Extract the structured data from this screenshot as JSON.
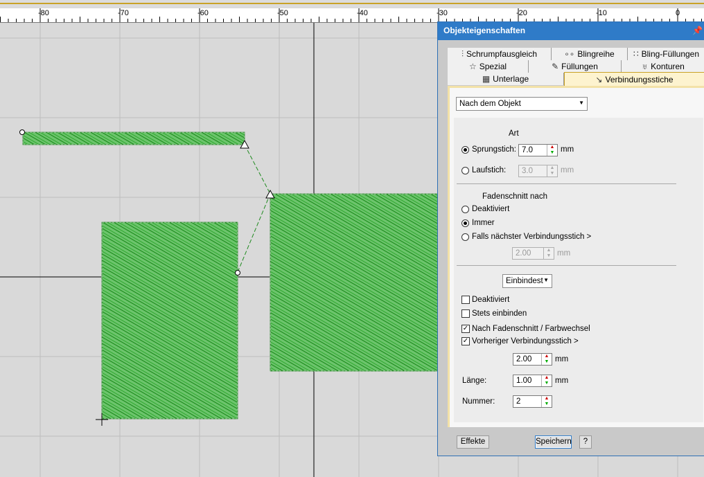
{
  "ruler": {
    "labels": [
      "-80",
      "-70",
      "-60",
      "-50",
      "-40",
      "-30",
      "-20",
      "-10",
      "0"
    ]
  },
  "colors": {
    "stitch_green": "#1f9a1f",
    "fill_green": "#5fbf5f",
    "dialog_blue": "#2f7bc8",
    "active_tab": "#fdf3cf"
  },
  "dialog": {
    "title": "Objekteigenschaften",
    "pin_icon": "pin-icon",
    "tabs_row1": [
      {
        "label": "Schrumpfausgleich",
        "icon": "shrink-icon"
      },
      {
        "label": "Blingreihe",
        "icon": "bling-row-icon"
      },
      {
        "label": "Bling-Füllungen",
        "icon": "bling-fill-icon"
      }
    ],
    "tabs_row2": [
      {
        "label": "Spezial",
        "icon": "star-icon"
      },
      {
        "label": "Füllungen",
        "icon": "fill-icon"
      },
      {
        "label": "Konturen",
        "icon": "contour-icon"
      }
    ],
    "tabs_row3": [
      {
        "label": "Unterlage",
        "icon": "underlay-icon"
      },
      {
        "label": "Verbindungsstiche",
        "icon": "connector-icon",
        "active": true
      }
    ],
    "mode_select": "Nach dem Objekt",
    "art_heading": "Art",
    "sprungstich_label": "Sprungstich:",
    "sprungstich_value": "7.0",
    "laufstich_label": "Laufstich:",
    "laufstich_value": "3.0",
    "unit_mm": "mm",
    "fadenschnitt_heading": "Fadenschnitt nach",
    "fs_deaktiviert": "Deaktiviert",
    "fs_immer": "Immer",
    "fs_falls": "Falls nächster Verbindungsstich >",
    "fs_value": "2.00",
    "einbindest_select": "Einbindest",
    "eb_deaktiviert": "Deaktiviert",
    "eb_stets": "Stets einbinden",
    "eb_nach": "Nach Fadenschnitt / Farbwechsel",
    "eb_vorheriger": "Vorheriger Verbindungsstich >",
    "eb_value": "2.00",
    "laenge_label": "Länge:",
    "laenge_value": "1.00",
    "nummer_label": "Nummer:",
    "nummer_value": "2",
    "effekte_button": "Effekte",
    "speichern_button": "Speichern",
    "help_button": "?"
  }
}
